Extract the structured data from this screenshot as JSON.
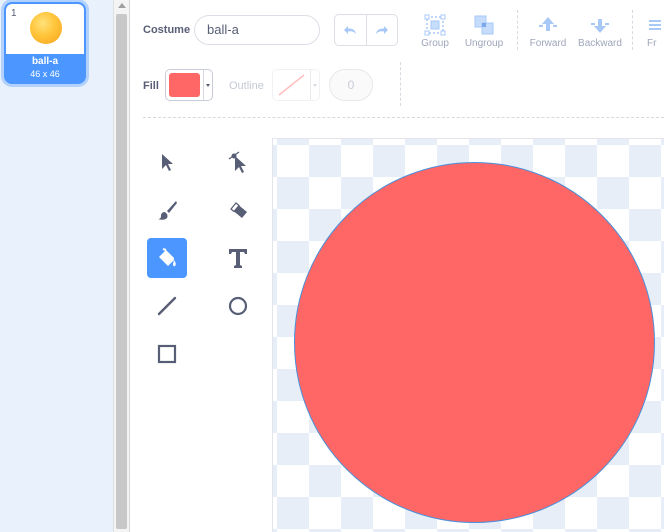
{
  "costume_list": {
    "items": [
      {
        "number": "1",
        "name": "ball-a",
        "size": "46 x 46",
        "selected": true
      }
    ]
  },
  "header": {
    "costume_label": "Costume",
    "costume_name": "ball-a"
  },
  "toolbar": {
    "undo_icon": "undo-icon",
    "redo_icon": "redo-icon",
    "group_label": "Group",
    "ungroup_label": "Ungroup",
    "forward_label": "Forward",
    "backward_label": "Backward",
    "front_label": "Fr"
  },
  "fill": {
    "label": "Fill",
    "color": "#ff6666"
  },
  "outline": {
    "label": "Outline",
    "width": "0"
  },
  "tools": [
    {
      "id": "select",
      "icon": "select-arrow-icon",
      "active": false
    },
    {
      "id": "reshape",
      "icon": "reshape-icon",
      "active": false
    },
    {
      "id": "brush",
      "icon": "brush-icon",
      "active": false
    },
    {
      "id": "eraser",
      "icon": "eraser-icon",
      "active": false
    },
    {
      "id": "fill",
      "icon": "fill-bucket-icon",
      "active": true
    },
    {
      "id": "text",
      "icon": "text-icon",
      "active": false
    },
    {
      "id": "line",
      "icon": "line-icon",
      "active": false
    },
    {
      "id": "circle",
      "icon": "circle-icon",
      "active": false
    },
    {
      "id": "rectangle",
      "icon": "rectangle-icon",
      "active": false
    }
  ],
  "canvas": {
    "shape": "circle",
    "fill_color": "#ff6666",
    "stroke_color": "#4a90d9"
  },
  "colors": {
    "accent": "#4c97ff",
    "text": "#575e75",
    "muted": "#9ea6bb"
  }
}
